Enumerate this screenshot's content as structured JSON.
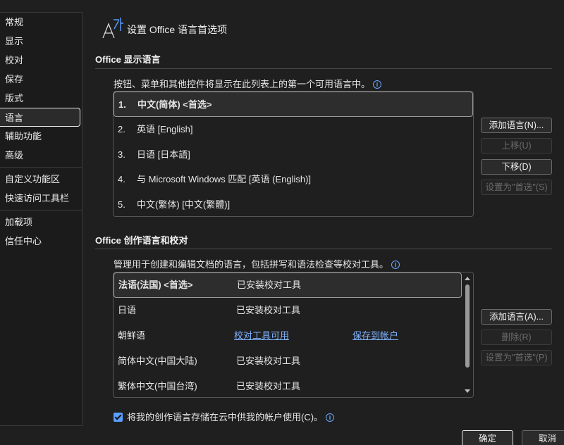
{
  "sidebar": {
    "items": [
      "常规",
      "显示",
      "校对",
      "保存",
      "版式",
      "语言",
      "辅助功能",
      "高级",
      "自定义功能区",
      "快速访问工具栏",
      "加载项",
      "信任中心"
    ],
    "active_index": 5
  },
  "header": {
    "title": "设置 Office 语言首选项",
    "icon": "language-icon"
  },
  "display": {
    "section_title": "Office 显示语言",
    "description": "按钮、菜单和其他控件将显示在此列表上的第一个可用语言中。",
    "languages": [
      {
        "num": "1.",
        "name": "中文(简体) <首选>"
      },
      {
        "num": "2.",
        "name": "英语 [English]"
      },
      {
        "num": "3.",
        "name": "日语 [日本語]"
      },
      {
        "num": "4.",
        "name": "与 Microsoft Windows 匹配 [英语 (English)]"
      },
      {
        "num": "5.",
        "name": "中文(繁体) [中文(繁體)]"
      }
    ],
    "buttons": {
      "add": "添加语言(N)...",
      "up": "上移(U)",
      "down": "下移(D)",
      "preferred": "设置为\"首选\"(S)"
    }
  },
  "authoring": {
    "section_title": "Office 创作语言和校对",
    "description": "管理用于创建和编辑文档的语言，包括拼写和语法检查等校对工具。",
    "rows": [
      {
        "language": "法语(法国) <首选>",
        "status": "已安装校对工具",
        "extra": ""
      },
      {
        "language": "日语",
        "status": "已安装校对工具",
        "extra": ""
      },
      {
        "language": "朝鲜语",
        "status": "校对工具可用",
        "extra": "保存到帐户"
      },
      {
        "language": "简体中文(中国大陆)",
        "status": "已安装校对工具",
        "extra": ""
      },
      {
        "language": "繁体中文(中国台湾)",
        "status": "已安装校对工具",
        "extra": ""
      }
    ],
    "buttons": {
      "add": "添加语言(A)...",
      "remove": "删除(R)",
      "preferred": "设置为\"首选\"(P)"
    },
    "checkbox_label": "将我的创作语言存储在云中供我的帐户使用(C)。",
    "checkbox_checked": true
  },
  "footer": {
    "ok": "确定",
    "cancel": "取消"
  },
  "colors": {
    "background": "#1f1f1f",
    "link": "#7fb3ff",
    "checkbox": "#5aa0ff"
  }
}
